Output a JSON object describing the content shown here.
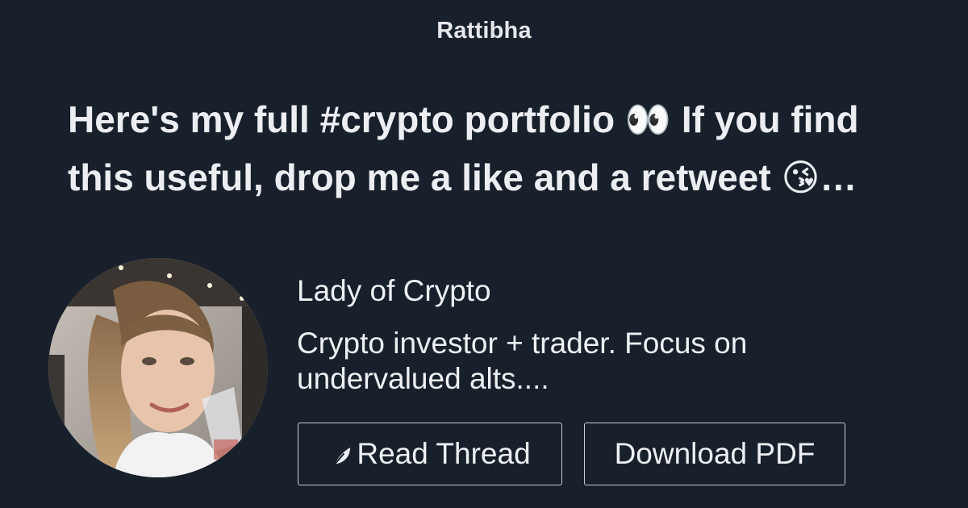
{
  "site": {
    "brand": "Rattibha"
  },
  "thread": {
    "headline_line1": "Here's my full #crypto portfolio 👀 If you find",
    "headline_line2": "this useful, drop me a like and a retweet 😘…"
  },
  "author": {
    "name": "Lady of Crypto",
    "bio_line1": "Crypto investor + trader. Focus on",
    "bio_line2": "undervalued alts....",
    "avatar_icon": "profile-photo"
  },
  "actions": {
    "read_thread_label": "Read Thread",
    "read_thread_icon": "feather-icon",
    "download_pdf_label": "Download PDF"
  },
  "colors": {
    "background": "#17202b",
    "text": "#eef0f3",
    "button_border": "#c9ced6"
  }
}
